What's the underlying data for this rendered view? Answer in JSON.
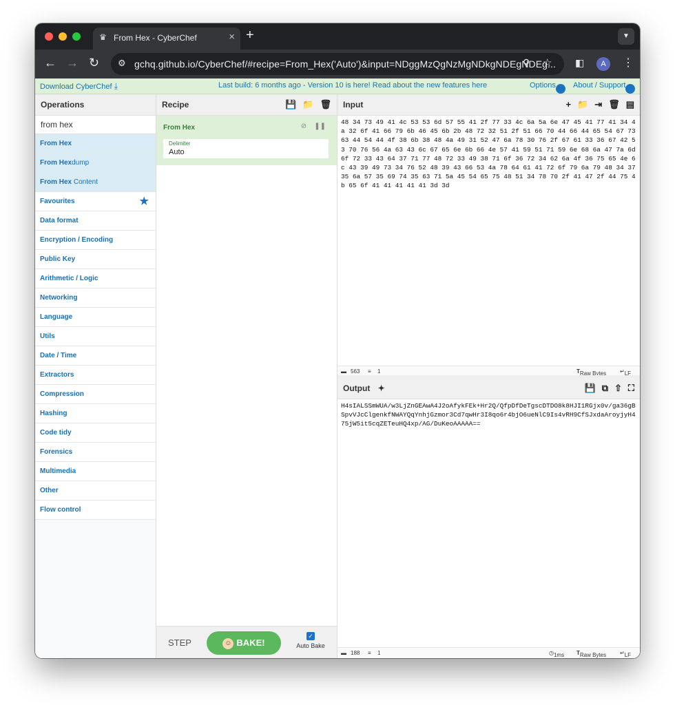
{
  "browser": {
    "tab_title": "From Hex - CyberChef",
    "url": "gchq.github.io/CyberChef/#recipe=From_Hex('Auto')&input=NDggMzQgNzMgNDkgNDEgNDEg...",
    "profile_initial": "A"
  },
  "banner": {
    "download": "Download CyberChef",
    "build_info": "Last build: 6 months ago - Version 10 is here! Read about the new features here",
    "options": "Options",
    "about": "About / Support"
  },
  "operations": {
    "title": "Operations",
    "search_value": "from hex",
    "results": [
      {
        "bold": "From Hex",
        "rest": ""
      },
      {
        "bold": "From Hex",
        "rest": "dump"
      },
      {
        "bold": "From Hex",
        "rest": " Content"
      }
    ],
    "categories": [
      "Favourites",
      "Data format",
      "Encryption / Encoding",
      "Public Key",
      "Arithmetic / Logic",
      "Networking",
      "Language",
      "Utils",
      "Date / Time",
      "Extractors",
      "Compression",
      "Hashing",
      "Code tidy",
      "Forensics",
      "Multimedia",
      "Other",
      "Flow control"
    ]
  },
  "recipe": {
    "title": "Recipe",
    "op_name": "From Hex",
    "arg_label": "Delimiter",
    "arg_value": "Auto",
    "step_label": "STEP",
    "bake_label": "BAKE!",
    "autobake_label": "Auto Bake"
  },
  "input": {
    "title": "Input",
    "text": "48 34 73 49 41 4c 53 53 6d 57 55 41 2f 77 33 4c 6a 5a 6e 47 45 41 77 41 34 4a 32 6f 41 66 79 6b 46 45 6b 2b 48 72 32 51 2f 51 66 70 44 66 44 65 54 67 73 63 44 54 44 4f 38 6b 38 48 4a 49 31 52 47 6a 78 30 76 2f 67 61 33 36 67 42 53 70 76 56 4a 63 43 6c 67 65 6e 6b 66 4e 57 41 59 51 71 59 6e 68 6a 47 7a 6d 6f 72 33 43 64 37 71 77 48 72 33 49 38 71 6f 36 72 34 62 6a 4f 36 75 65 4e 6c 43 39 49 73 34 76 52 48 39 43 66 53 4a 78 64 61 41 72 6f 79 6a 79 48 34 37 35 6a 57 35 69 74 35 63 71 5a 45 54 65 75 48 51 34 78 70 2f 41 47 2f 44 75 4b 65 6f 41 41 41 41 41 3d 3d",
    "length": "563",
    "lines": "1",
    "raw_bytes": "Raw Bytes",
    "eol": "LF"
  },
  "output": {
    "title": "Output",
    "text": "H4sIALSSmWUA/w3LjZnGEAwA4J2oAfykFEk+Hr2Q/QfpDfDeTgscDTDO8k8HJI1RGjx0v/ga36gBSpvVJcClgenkfNWAYQqYnhjGzmor3Cd7qwHr3I8qo6r4bjO6ueNlC9Is4vRH9CfSJxdaAroyjyH475jW5it5cqZETeuHQ4xp/AG/DuKeoAAAAA==",
    "length": "188",
    "lines": "1",
    "time": "1ms",
    "raw_bytes": "Raw Bytes",
    "eol": "LF"
  },
  "colors": {
    "accent": "#1a73c8",
    "bake_green": "#5cb85c",
    "recipe_op_bg": "#dff0d8",
    "op_highlight": "#d9ecf5"
  }
}
